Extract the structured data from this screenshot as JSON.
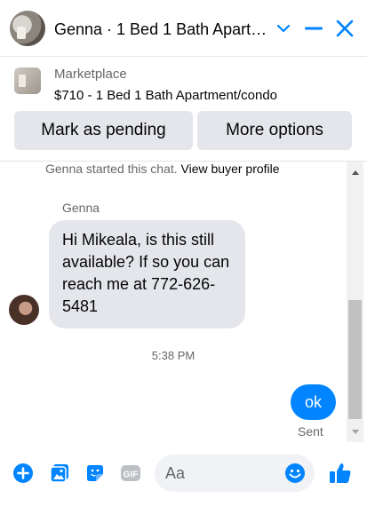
{
  "header": {
    "title": "Genna · 1 Bed 1 Bath Apartment/condo",
    "icons": [
      "chevron-down-icon",
      "minimize-icon",
      "close-icon"
    ],
    "accent": "#0084ff"
  },
  "listing": {
    "label": "Marketplace",
    "item": "$710 - 1 Bed 1 Bath Apartment/condo",
    "buttons": {
      "mark_pending": "Mark as pending",
      "more_options": "More options"
    }
  },
  "chat": {
    "started_text": "Genna started this chat.",
    "view_profile": "View buyer profile",
    "sender_name": "Genna",
    "incoming_message": "Hi Mikeala, is this still available? If so you can reach me at 772-626-5481",
    "timestamp": "5:38 PM",
    "outgoing_message": "ok",
    "status": "Sent"
  },
  "composer": {
    "placeholder": "Aa",
    "icons": [
      "add-icon",
      "photo-icon",
      "sticker-icon",
      "gif-icon",
      "emoji-icon",
      "thumbs-up-icon"
    ]
  }
}
